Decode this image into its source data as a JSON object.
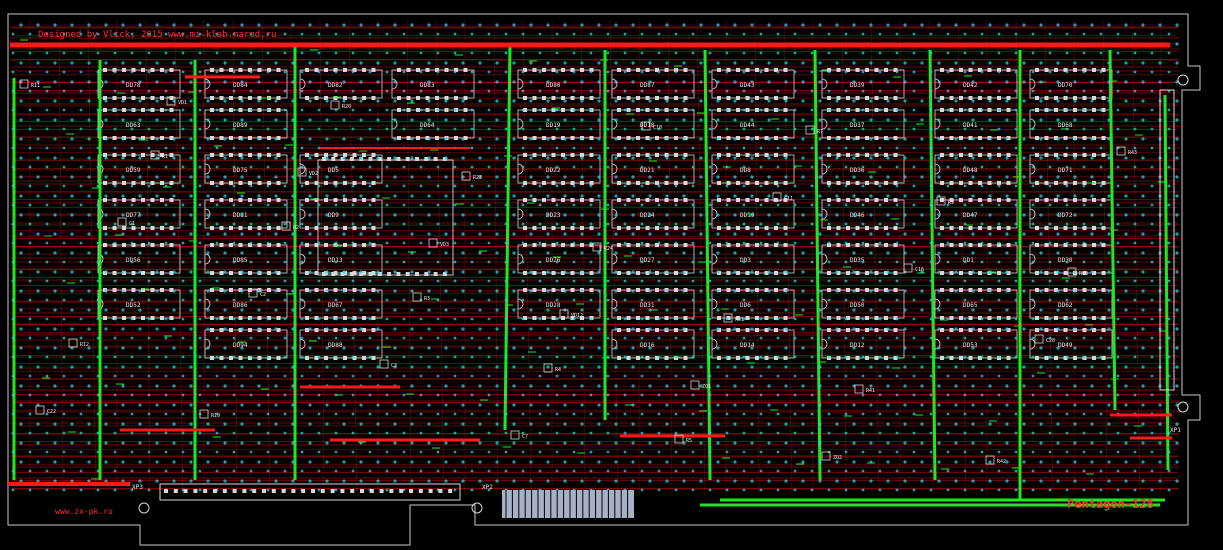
{
  "board": {
    "designer_text": "Designed by Vlick, 2015 www.mi-klab.narod.ru",
    "footer_url": "www.zx-pk.ru",
    "product_name": "Pentagon-128",
    "connectors": [
      "XP3",
      "XP2",
      "XP1"
    ],
    "colors": {
      "background": "#000000",
      "trace_red": "#d01818",
      "trace_green": "#20e820",
      "power_rail": "#ff1a1a",
      "via_cyan": "#20d8e8",
      "silkscreen": "#d8d8d8",
      "outline": "#c8c8c8",
      "gold_pad": "#a8b0c8"
    }
  },
  "components": [
    {
      "ref": "DD78",
      "col": 0,
      "row": 0
    },
    {
      "ref": "DD84",
      "col": 1,
      "row": 0
    },
    {
      "ref": "DD82",
      "col": 2,
      "row": 0
    },
    {
      "ref": "DD83",
      "col": 3,
      "row": 0
    },
    {
      "ref": "DD80",
      "col": 4,
      "row": 0
    },
    {
      "ref": "DD87",
      "col": 5,
      "row": 0
    },
    {
      "ref": "DD43",
      "col": 6,
      "row": 0
    },
    {
      "ref": "DD39",
      "col": 7,
      "row": 0
    },
    {
      "ref": "DD42",
      "col": 8,
      "row": 0
    },
    {
      "ref": "DD70",
      "col": 9,
      "row": 0
    },
    {
      "ref": "DD63",
      "col": 0,
      "row": 1
    },
    {
      "ref": "DD89",
      "col": 1,
      "row": 1
    },
    {
      "ref": "DD64",
      "col": 3,
      "row": 1
    },
    {
      "ref": "DD19",
      "col": 4,
      "row": 1
    },
    {
      "ref": "DD18",
      "col": 5,
      "row": 1
    },
    {
      "ref": "DD44",
      "col": 6,
      "row": 1
    },
    {
      "ref": "DD37",
      "col": 7,
      "row": 1
    },
    {
      "ref": "DD41",
      "col": 8,
      "row": 1
    },
    {
      "ref": "DD68",
      "col": 9,
      "row": 1
    },
    {
      "ref": "DD59",
      "col": 0,
      "row": 2
    },
    {
      "ref": "DD75",
      "col": 1,
      "row": 2
    },
    {
      "ref": "DD5",
      "col": 2,
      "row": 2
    },
    {
      "ref": "DD22",
      "col": 4,
      "row": 2
    },
    {
      "ref": "DD21",
      "col": 5,
      "row": 2
    },
    {
      "ref": "DD8",
      "col": 6,
      "row": 2
    },
    {
      "ref": "DD36",
      "col": 7,
      "row": 2
    },
    {
      "ref": "DD48",
      "col": 8,
      "row": 2
    },
    {
      "ref": "DD71",
      "col": 9,
      "row": 2
    },
    {
      "ref": "DD77",
      "col": 0,
      "row": 3
    },
    {
      "ref": "DD81",
      "col": 1,
      "row": 3
    },
    {
      "ref": "DD9",
      "col": 2,
      "row": 3
    },
    {
      "ref": "DD23",
      "col": 4,
      "row": 3
    },
    {
      "ref": "DD24",
      "col": 5,
      "row": 3
    },
    {
      "ref": "DD10",
      "col": 6,
      "row": 3
    },
    {
      "ref": "DD46",
      "col": 7,
      "row": 3
    },
    {
      "ref": "DD47",
      "col": 8,
      "row": 3
    },
    {
      "ref": "DD72",
      "col": 9,
      "row": 3
    },
    {
      "ref": "DD56",
      "col": 0,
      "row": 4
    },
    {
      "ref": "DD85",
      "col": 1,
      "row": 4
    },
    {
      "ref": "DD13",
      "col": 2,
      "row": 4
    },
    {
      "ref": "DD26",
      "col": 4,
      "row": 4
    },
    {
      "ref": "DD27",
      "col": 5,
      "row": 4
    },
    {
      "ref": "DD3",
      "col": 6,
      "row": 4
    },
    {
      "ref": "DD35",
      "col": 7,
      "row": 4
    },
    {
      "ref": "DD1",
      "col": 8,
      "row": 4
    },
    {
      "ref": "DD30",
      "col": 9,
      "row": 4
    },
    {
      "ref": "DD52",
      "col": 0,
      "row": 5
    },
    {
      "ref": "DD86",
      "col": 1,
      "row": 5
    },
    {
      "ref": "DD67",
      "col": 2,
      "row": 5
    },
    {
      "ref": "DD28",
      "col": 4,
      "row": 5
    },
    {
      "ref": "DD31",
      "col": 5,
      "row": 5
    },
    {
      "ref": "DD6",
      "col": 6,
      "row": 5
    },
    {
      "ref": "DD50",
      "col": 7,
      "row": 5
    },
    {
      "ref": "DD65",
      "col": 8,
      "row": 5
    },
    {
      "ref": "DD62",
      "col": 9,
      "row": 5
    },
    {
      "ref": "DD94",
      "col": 1,
      "row": 6
    },
    {
      "ref": "DD88",
      "col": 2,
      "row": 6
    },
    {
      "ref": "DD16",
      "col": 5,
      "row": 6
    },
    {
      "ref": "DD14",
      "col": 6,
      "row": 6
    },
    {
      "ref": "DD12",
      "col": 7,
      "row": 6
    },
    {
      "ref": "DD53",
      "col": 8,
      "row": 6
    },
    {
      "ref": "DD49",
      "col": 9,
      "row": 6
    }
  ],
  "passives": [
    "R11",
    "R1",
    "R2",
    "R3",
    "R4",
    "R5",
    "R7",
    "R9",
    "R10",
    "R12",
    "R19",
    "R20",
    "R23",
    "R24",
    "R31",
    "R41",
    "R42",
    "R43",
    "C1",
    "C2",
    "C3",
    "C7",
    "C10",
    "C11",
    "C16",
    "C20",
    "C22",
    "VD1",
    "VD2",
    "VD3",
    "VD12",
    "ZQ1",
    "ZQ2"
  ]
}
